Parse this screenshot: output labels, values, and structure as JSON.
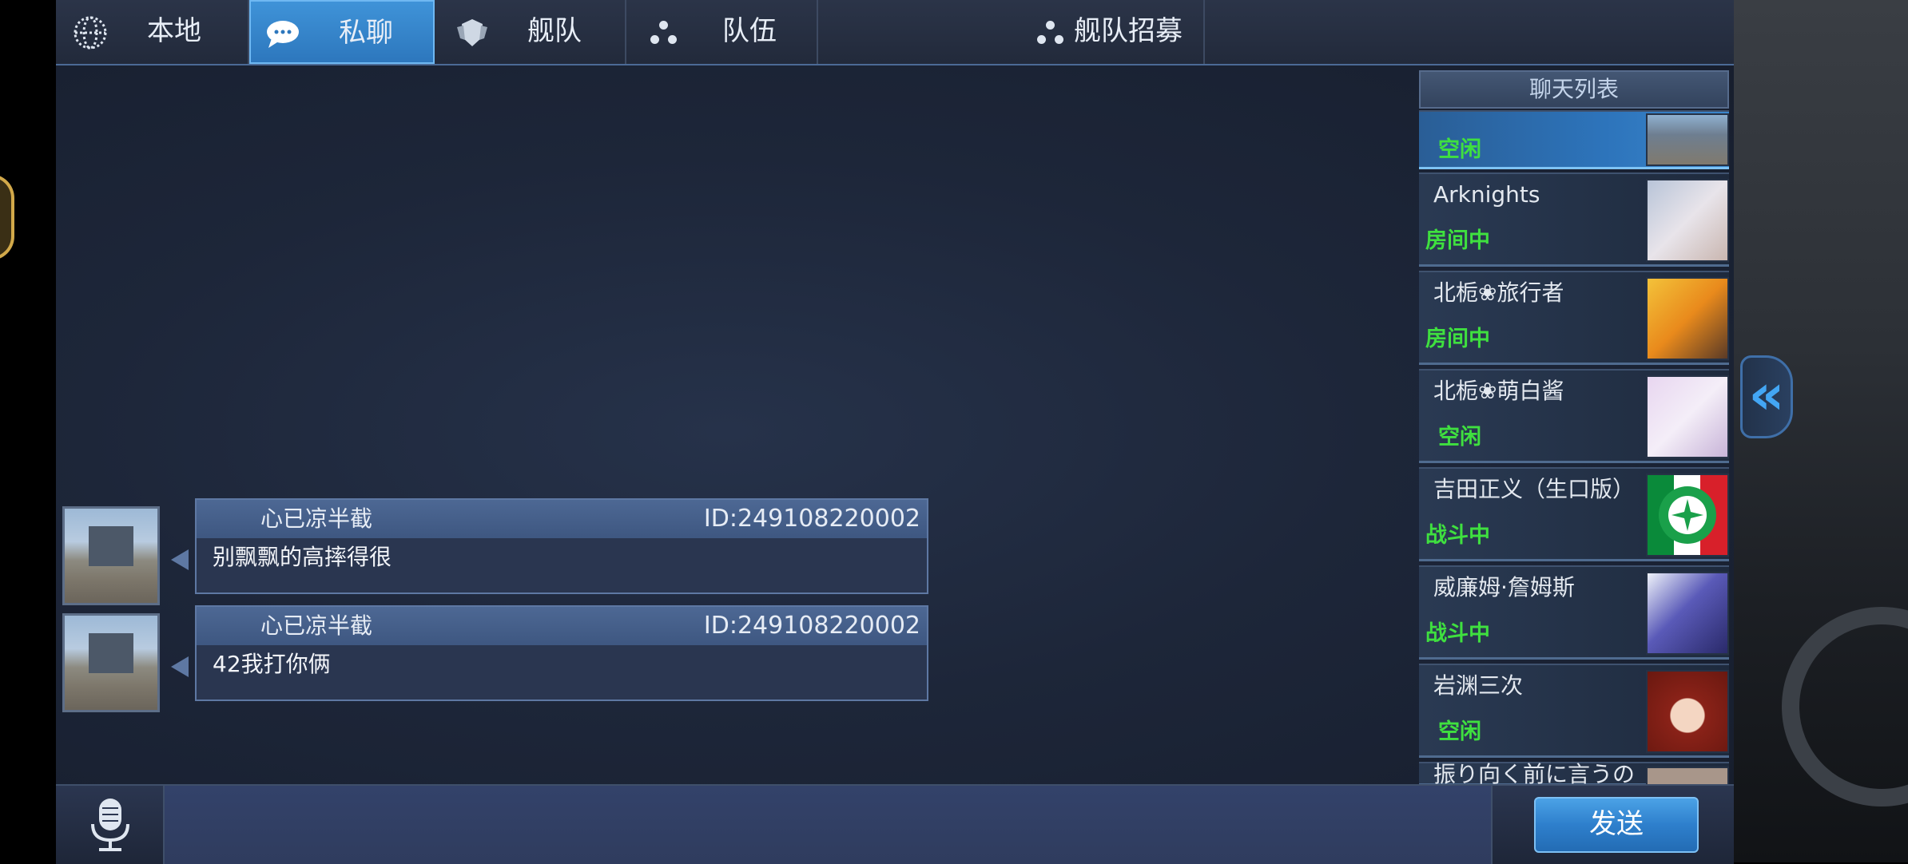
{
  "tabs": [
    {
      "label": "本地",
      "icon": "globe-icon"
    },
    {
      "label": "私聊",
      "icon": "chat-bubbles-icon"
    },
    {
      "label": "舰队",
      "icon": "fleet-shield-icon"
    },
    {
      "label": "队伍",
      "icon": "team-dots-icon"
    },
    {
      "label": "舰队招募",
      "icon": "team-dots-icon"
    }
  ],
  "active_tab": "私聊",
  "messages": [
    {
      "name": "心已凉半截",
      "id": "ID:249108220002",
      "text": "别飘飘的高摔得很"
    },
    {
      "name": "心已凉半截",
      "id": "ID:249108220002",
      "text": "42我打你俩"
    }
  ],
  "chat_list": {
    "title": "聊天列表",
    "items": [
      {
        "name": "",
        "status": "空闲"
      },
      {
        "name": "Arknights",
        "status": "房间中"
      },
      {
        "name": "北栀❀旅行者",
        "status": "房间中"
      },
      {
        "name": "北栀❀萌白酱",
        "status": "空闲"
      },
      {
        "name": "吉田正义（生口版）",
        "status": "战斗中"
      },
      {
        "name": "威廉姆·詹姆斯",
        "status": "战斗中"
      },
      {
        "name": "岩渊三次",
        "status": "空闲"
      },
      {
        "name": "振り向く前に言うの",
        "status": ""
      }
    ]
  },
  "side_arrow": "«",
  "bottom": {
    "input_value": "",
    "send_label": "发送"
  },
  "colors": {
    "accent": "#3f93d8",
    "status_green": "#3fe03f",
    "panel": "#1d2639"
  }
}
